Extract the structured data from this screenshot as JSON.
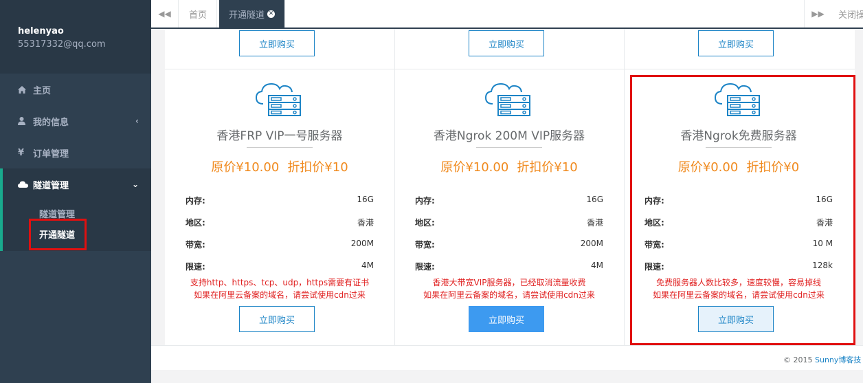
{
  "sidebar": {
    "user_name": "helenyao",
    "user_email": "55317332@qq.com",
    "items": [
      {
        "label": "主页",
        "icon": "home-icon"
      },
      {
        "label": "我的信息",
        "icon": "user-icon"
      },
      {
        "label": "订单管理",
        "icon": "yen-icon"
      },
      {
        "label": "隧道管理",
        "icon": "cloud-icon"
      }
    ],
    "submenu": [
      {
        "label": "隧道管理"
      },
      {
        "label": "开通隧道"
      }
    ]
  },
  "tabs": {
    "home": "首页",
    "active": "开通隧道",
    "close_ops": "关闭操作"
  },
  "buy_label": "立即购买",
  "cards": [
    {
      "title": "香港FRP VIP一号服务器",
      "orig_price": "原价¥10.00",
      "disc_price": "折扣价¥10",
      "specs": [
        {
          "k": "内存:",
          "v": "16G"
        },
        {
          "k": "地区:",
          "v": "香港"
        },
        {
          "k": "带宽:",
          "v": "200M"
        },
        {
          "k": "限速:",
          "v": "4M"
        }
      ],
      "note1": "支持http、https、tcp、udp，https需要有证书",
      "note2": "如果在阿里云备案的域名，请尝试使用cdn过来"
    },
    {
      "title": "香港Ngrok 200M VIP服务器",
      "orig_price": "原价¥10.00",
      "disc_price": "折扣价¥10",
      "specs": [
        {
          "k": "内存:",
          "v": "16G"
        },
        {
          "k": "地区:",
          "v": "香港"
        },
        {
          "k": "带宽:",
          "v": "200M"
        },
        {
          "k": "限速:",
          "v": "4M"
        }
      ],
      "note1": "香港大带宽VIP服务器，已经取消流量收费",
      "note2": "如果在阿里云备案的域名，请尝试使用cdn过来"
    },
    {
      "title": "香港Ngrok免费服务器",
      "orig_price": "原价¥0.00",
      "disc_price": "折扣价¥0",
      "specs": [
        {
          "k": "内存:",
          "v": "16G"
        },
        {
          "k": "地区:",
          "v": "香港"
        },
        {
          "k": "带宽:",
          "v": "10 M"
        },
        {
          "k": "限速:",
          "v": "128k"
        }
      ],
      "note1": "免费服务器人数比较多，速度较慢，容易掉线",
      "note2": "如果在阿里云备案的域名，请尝试使用cdn过来"
    }
  ],
  "footer": {
    "copyright": "© 2015 ",
    "link": "Sunny博客技"
  },
  "colors": {
    "sidebar_bg": "#2f4050",
    "accent": "#19aa8d",
    "price": "#f08a1e",
    "note": "#e02020",
    "highlight_box": "#e01010",
    "primary_btn": "#3d9af0"
  }
}
